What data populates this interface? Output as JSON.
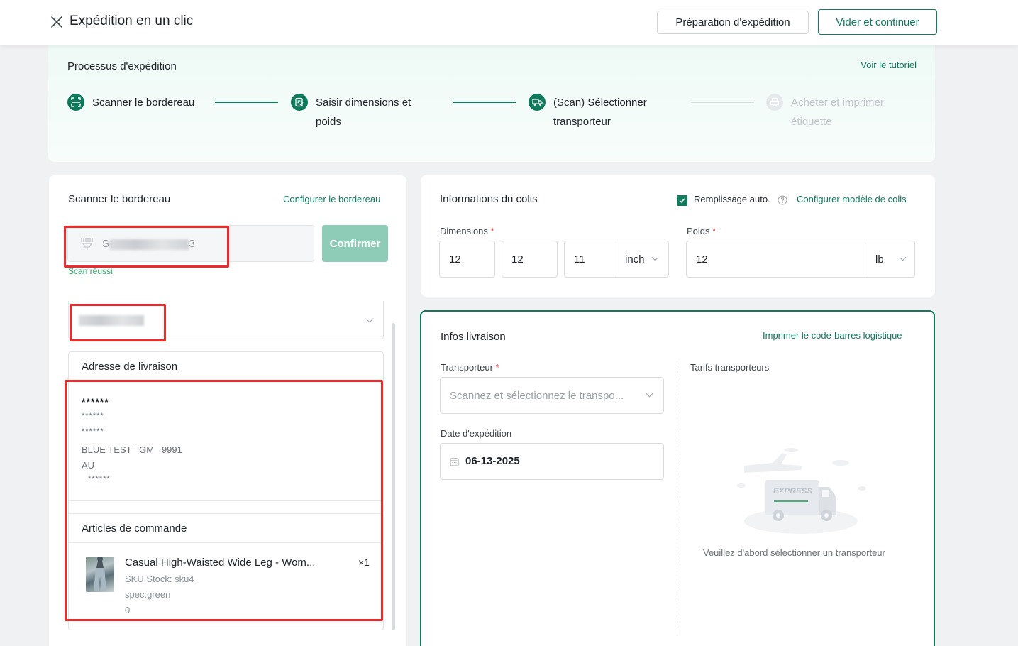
{
  "header": {
    "title": "Expédition en un clic",
    "prep_button": "Préparation d'expédition",
    "clear_button": "Vider et continuer"
  },
  "process": {
    "title": "Processus d'expédition",
    "tutorial_link": "Voir le tutoriel",
    "steps": [
      {
        "label": "Scanner le bordereau",
        "state": "done",
        "icon": "scan-icon"
      },
      {
        "label": "Saisir dimensions et poids",
        "state": "done",
        "icon": "edit-form-icon"
      },
      {
        "label": "(Scan) Sélectionner transporteur",
        "state": "active",
        "icon": "truck-icon"
      },
      {
        "label": "Acheter et imprimer étiquette",
        "state": "disabled",
        "icon": "printer-icon"
      }
    ]
  },
  "scan_panel": {
    "title": "Scanner le bordereau",
    "config_link": "Configurer le bordereau",
    "input_value_start": "S",
    "input_value_end": "3",
    "confirm_button": "Confirmer",
    "status": "Scan réussi",
    "address": {
      "heading": "Adresse de livraison",
      "name": "******",
      "line1": "******",
      "line2": "******",
      "line3": "BLUE TEST   GM   9991",
      "line4": "AU",
      "line5": "******"
    },
    "articles": {
      "heading": "Articles de commande",
      "items": [
        {
          "name": "Casual High-Waisted Wide Leg - Wom...",
          "qty": "×1",
          "sku": "SKU Stock: sku4",
          "spec": "spec:green",
          "extra": "0"
        }
      ]
    }
  },
  "parcel_panel": {
    "title": "Informations du colis",
    "auto_fill_label": "Remplissage auto.",
    "auto_fill_checked": true,
    "config_link": "Configurer modèle de colis",
    "dimensions_label": "Dimensions",
    "length": "12",
    "width": "12",
    "height": "11",
    "dim_unit": "inch",
    "weight_label": "Poids",
    "weight": "12",
    "weight_unit": "lb",
    "required_mark": "*"
  },
  "shipping_panel": {
    "title": "Infos livraison",
    "barcode_link": "Imprimer le code-barres logistique",
    "carrier_label": "Transporteur",
    "carrier_placeholder": "Scannez et sélectionnez le transpo...",
    "date_label": "Date d'expédition",
    "date_value": "06-13-2025",
    "rates_label": "Tarifs transporteurs",
    "empty_badge": "EXPRESS",
    "empty_message": "Veuillez d'abord sélectionner un transporteur"
  },
  "colors": {
    "accent": "#0f7a5c",
    "confirm_disabled": "#8fccb8",
    "success": "#27a665",
    "required": "#e53935",
    "annotation": "#ee2a2a"
  }
}
